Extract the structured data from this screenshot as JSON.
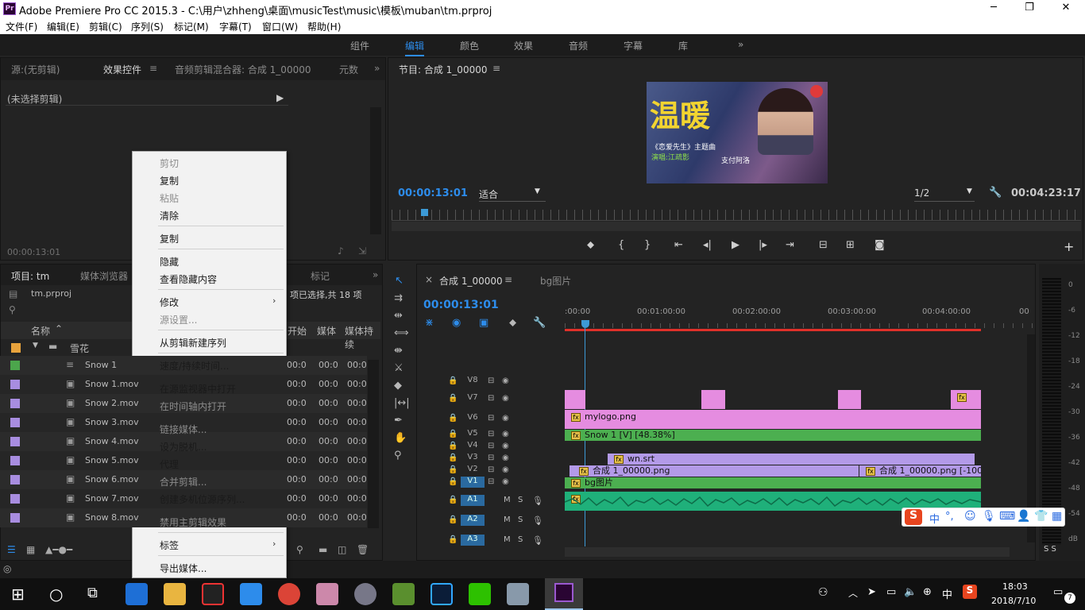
{
  "titlebar": {
    "app_icon": "Pr",
    "title": "Adobe Premiere Pro CC 2015.3 - C:\\用户\\zhheng\\桌面\\musicTest\\music\\模板\\muban\\tm.prproj",
    "minimize": "─",
    "maximize": "❐",
    "close": "✕"
  },
  "menu": [
    "文件(F)",
    "编辑(E)",
    "剪辑(C)",
    "序列(S)",
    "标记(M)",
    "字幕(T)",
    "窗口(W)",
    "帮助(H)"
  ],
  "workspaces": {
    "items": [
      "组件",
      "编辑",
      "颜色",
      "效果",
      "音频",
      "字幕",
      "库"
    ],
    "active": "编辑",
    "more": "»"
  },
  "source_panel": {
    "tabs": [
      "源:(无剪辑)",
      "效果控件",
      "音频剪辑混合器: 合成 1_00000",
      "元数"
    ],
    "active": "效果控件",
    "no_clip": "(未选择剪辑)",
    "timecode": "00:00:13:01"
  },
  "program": {
    "title": "节目: 合成 1_00000",
    "timecode": "00:00:13:01",
    "fit": "适合",
    "resolution": "1/2",
    "duration": "00:04:23:17",
    "overlay_title": "温暖",
    "overlay_sub": "《恋爱先生》主题曲",
    "overlay_singer": "演唱:江疏影",
    "overlay_credit": "支付阿洛"
  },
  "project": {
    "tabs": [
      "项目: tm",
      "媒体浏览器",
      "标记"
    ],
    "file": "tm.prproj",
    "selection_info": "项已选择,共 18 项",
    "col_name": "名称",
    "col_start": "开始",
    "col_media": "媒体",
    "col_media2": "媒体持续",
    "folder": "雪花",
    "items": [
      {
        "name": "Snow 1",
        "color": "#4ca64c",
        "start": "00:0",
        "m1": "00:0",
        "m2": "00:0"
      },
      {
        "name": "Snow 1.mov",
        "color": "#a88de0",
        "start": "00:0",
        "m1": "00:0",
        "m2": "00:0"
      },
      {
        "name": "Snow 2.mov",
        "color": "#a88de0",
        "start": "00:0",
        "m1": "00:0",
        "m2": "00:0"
      },
      {
        "name": "Snow 3.mov",
        "color": "#a88de0",
        "start": "00:0",
        "m1": "00:0",
        "m2": "00:0"
      },
      {
        "name": "Snow 4.mov",
        "color": "#a88de0",
        "start": "00:0",
        "m1": "00:0",
        "m2": "00:0"
      },
      {
        "name": "Snow 5.mov",
        "color": "#a88de0",
        "start": "00:0",
        "m1": "00:0",
        "m2": "00:0"
      },
      {
        "name": "Snow 6.mov",
        "color": "#a88de0",
        "start": "00:0",
        "m1": "00:0",
        "m2": "00:0"
      },
      {
        "name": "Snow 7.mov",
        "color": "#a88de0",
        "start": "00:0",
        "m1": "00:0",
        "m2": "00:0"
      },
      {
        "name": "Snow 8.mov",
        "color": "#a88de0",
        "start": "00:0",
        "m1": "00:0",
        "m2": "00:0"
      }
    ]
  },
  "context_menu": [
    {
      "label": "剪切",
      "disabled": true
    },
    {
      "label": "复制",
      "disabled": false
    },
    {
      "label": "粘贴",
      "disabled": true
    },
    {
      "label": "清除",
      "disabled": false
    },
    {
      "label": "复制",
      "disabled": false
    },
    {
      "label": "隐藏",
      "disabled": false
    },
    {
      "label": "查看隐藏内容",
      "disabled": false
    },
    {
      "label": "修改",
      "disabled": false
    },
    {
      "label": "源设置...",
      "disabled": true
    },
    {
      "label": "从剪辑新建序列",
      "disabled": false
    },
    {
      "label": "速度/持续时间...",
      "disabled": false
    },
    {
      "label": "在源监视器中打开",
      "disabled": false
    },
    {
      "label": "在时间轴内打开",
      "disabled": true
    },
    {
      "label": "链接媒体...",
      "disabled": true
    },
    {
      "label": "设为脱机...",
      "disabled": false
    },
    {
      "label": "代理",
      "disabled": false
    },
    {
      "label": "合并剪辑...",
      "disabled": true
    },
    {
      "label": "创建多机位源序列...",
      "disabled": false
    },
    {
      "label": "禁用主剪辑效果",
      "disabled": true
    },
    {
      "label": "标签",
      "disabled": false
    },
    {
      "label": "导出媒体...",
      "disabled": false
    }
  ],
  "timeline": {
    "tabs": [
      "合成 1_00000",
      "bg图片"
    ],
    "timecode": "00:00:13:01",
    "ruler": [
      ":00:00",
      "00:01:00:00",
      "00:02:00:00",
      "00:03:00:00",
      "00:04:00:00",
      "00"
    ],
    "tracks": [
      "V8",
      "V7",
      "V6",
      "V5",
      "V4",
      "V3",
      "V2",
      "V1",
      "A1",
      "A2",
      "A3"
    ],
    "clips": {
      "v6": "mylogo.png",
      "v5": "Snow 1 [V] [48.38%]",
      "v3": "wn.srt",
      "v2a": "合成 1_00000.png",
      "v2b": "合成 1_00000.png [-100",
      "v1": "bg图片",
      "fx": "fx"
    },
    "audio_ms": [
      "M",
      "S"
    ]
  },
  "meter_scale": [
    "0",
    "-6",
    "-12",
    "-18",
    "-24",
    "-30",
    "-36",
    "-42",
    "-48",
    "-54",
    "dB"
  ],
  "meter_solo": "S S",
  "ime": {
    "chars": [
      "中",
      "°,"
    ]
  },
  "tray": {
    "time": "18:03",
    "date": "2018/7/10",
    "lang": "中",
    "notif": "7"
  },
  "colors": {
    "accent": "#2d8ceb",
    "clip_pink": "#e58ce0",
    "clip_green": "#4caf50",
    "clip_purple": "#b39ae8",
    "audio_teal": "#1fb07a",
    "menu_highlight": "#99c9ef",
    "playhead": "#3c9ad6"
  }
}
